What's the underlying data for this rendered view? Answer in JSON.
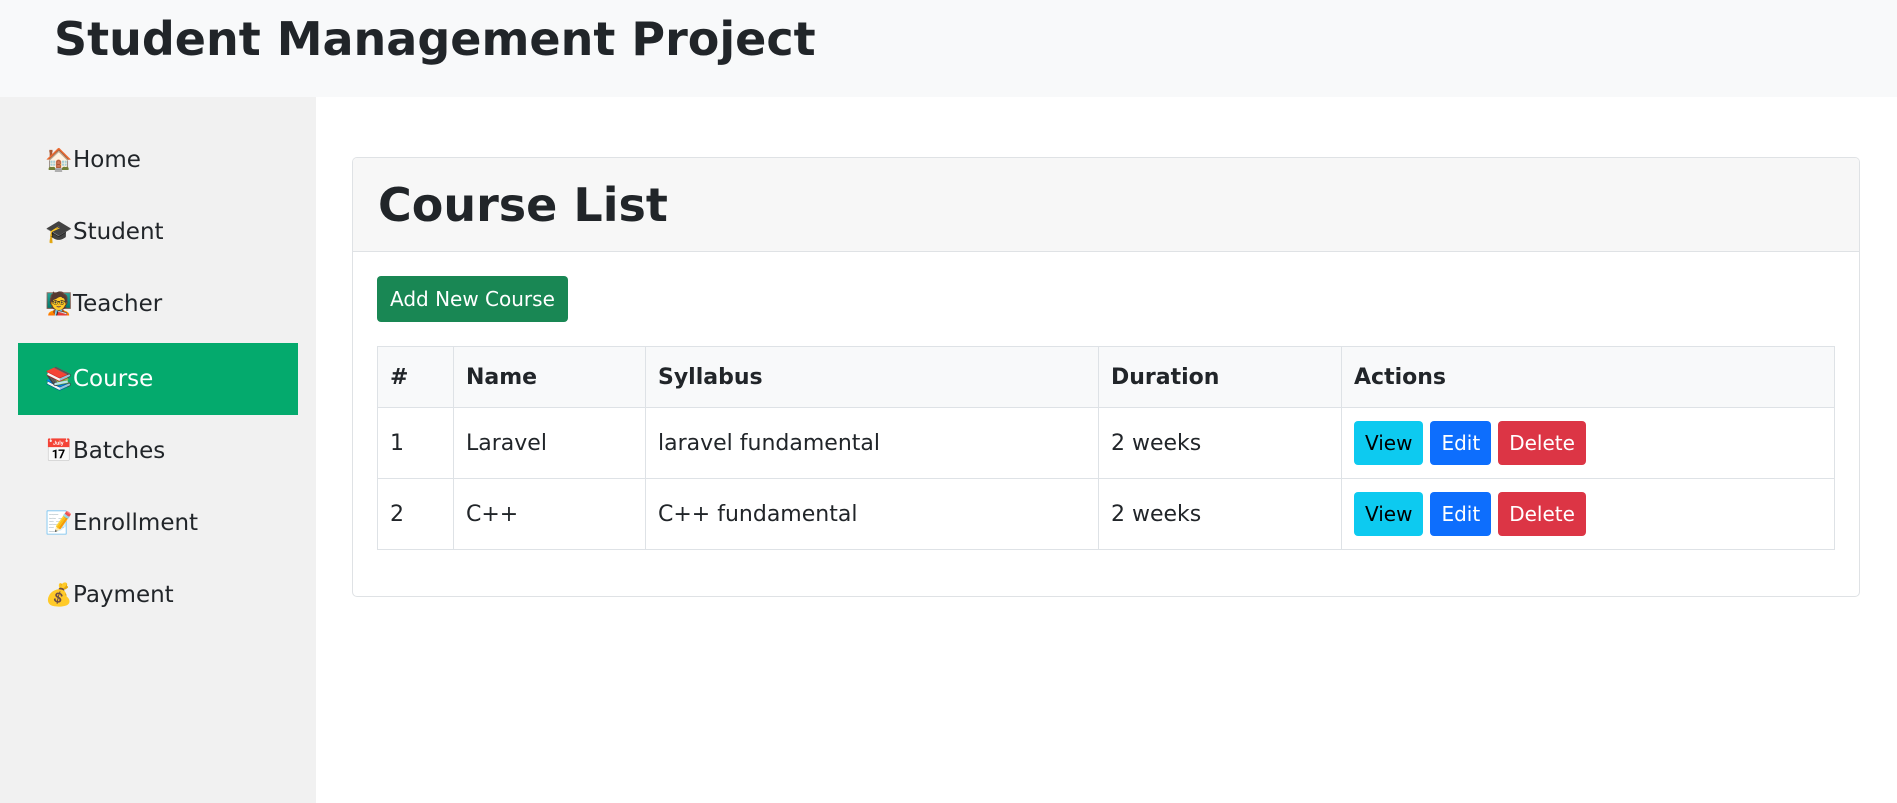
{
  "header": {
    "title": "Student Management Project"
  },
  "sidebar": {
    "items": [
      {
        "icon": "🏠",
        "label": "Home"
      },
      {
        "icon": "🎓",
        "label": "Student"
      },
      {
        "icon": "🧑‍🏫",
        "label": "Teacher"
      },
      {
        "icon": "📚",
        "label": "Course"
      },
      {
        "icon": "📅",
        "label": "Batches"
      },
      {
        "icon": "📝",
        "label": "Enrollment"
      },
      {
        "icon": "💰",
        "label": "Payment"
      }
    ],
    "active": "Course",
    "active_color": "#04aa6d"
  },
  "main": {
    "title": "Course List",
    "add_button_label": "Add New Course",
    "table": {
      "headers": [
        "#",
        "Name",
        "Syllabus",
        "Duration",
        "Actions"
      ],
      "rows": [
        {
          "num": "1",
          "name": "Laravel",
          "syllabus": "laravel fundamental",
          "duration": "2 weeks"
        },
        {
          "num": "2",
          "name": "C++",
          "syllabus": "C++ fundamental",
          "duration": "2 weeks"
        }
      ]
    },
    "actions": {
      "view": "View",
      "edit": "Edit",
      "delete": "Delete"
    }
  },
  "colors": {
    "add": "#198754",
    "view": "#0dcaf0",
    "edit": "#0d6efd",
    "delete": "#dc3545"
  }
}
